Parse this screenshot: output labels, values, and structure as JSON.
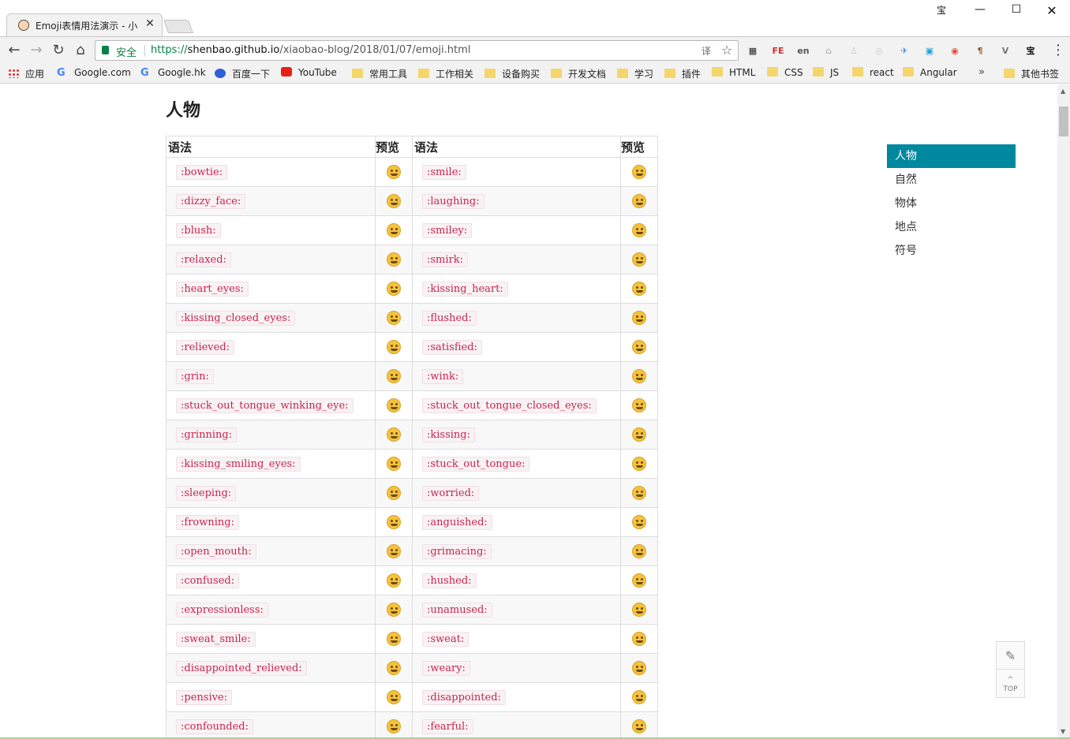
{
  "browser": {
    "tab_title": "Emoji表情用法演示 - 小",
    "tab_close": "✕",
    "window_controls": {
      "account": "宝",
      "minimize": "—",
      "maximize": "☐",
      "close": "✕"
    }
  },
  "toolbar": {
    "back": "←",
    "forward": "→",
    "reload": "↻",
    "home": "⌂",
    "secure_label": "安全",
    "url_scheme": "https://",
    "url_host": "shenbao.github.io",
    "url_path": "/xiaobao-blog/2018/01/07/emoji.html",
    "translate": "译",
    "star": "☆",
    "menu": "⋮",
    "extensions": [
      {
        "name": "qr-code-icon",
        "glyph": "▦",
        "color": "#222222"
      },
      {
        "name": "fe-helper-icon",
        "glyph": "FE",
        "color": "#d32f2f"
      },
      {
        "name": "en-dict-icon",
        "glyph": "en",
        "color": "#555555"
      },
      {
        "name": "pdf-icon",
        "glyph": "⌂",
        "color": "#bbbbbb"
      },
      {
        "name": "puzzle-icon",
        "glyph": "♙",
        "color": "#cccccc"
      },
      {
        "name": "circle-ext-icon",
        "glyph": "◎",
        "color": "#cccccc"
      },
      {
        "name": "bird-ext-icon",
        "glyph": "✈",
        "color": "#3b8fd8"
      },
      {
        "name": "window-ext-icon",
        "glyph": "▣",
        "color": "#2a9fd8"
      },
      {
        "name": "chrome-ext-icon",
        "glyph": "◉",
        "color": "#e04b3a"
      },
      {
        "name": "pilcrow-icon",
        "glyph": "¶",
        "color": "#8a5a1a"
      },
      {
        "name": "vue-devtools-icon",
        "glyph": "V",
        "color": "#777777"
      },
      {
        "name": "taobao-icon",
        "glyph": "宝",
        "color": "#111111"
      }
    ]
  },
  "bookmarks": {
    "apps": "应用",
    "items": [
      {
        "label": "Google.com",
        "type": "google"
      },
      {
        "label": "Google.hk",
        "type": "google"
      },
      {
        "label": "百度一下",
        "type": "baidu"
      },
      {
        "label": "YouTube",
        "type": "youtube"
      },
      {
        "label": "常用工具",
        "type": "folder"
      },
      {
        "label": "工作相关",
        "type": "folder"
      },
      {
        "label": "设备购买",
        "type": "folder"
      },
      {
        "label": "开发文档",
        "type": "folder"
      },
      {
        "label": "学习",
        "type": "folder"
      },
      {
        "label": "插件",
        "type": "folder"
      },
      {
        "label": "HTML",
        "type": "folder"
      },
      {
        "label": "CSS",
        "type": "folder"
      },
      {
        "label": "JS",
        "type": "folder"
      },
      {
        "label": "react",
        "type": "folder"
      },
      {
        "label": "Angular",
        "type": "folder"
      }
    ],
    "more": "»",
    "other": "其他书签"
  },
  "page": {
    "title": "人物",
    "table_headers": [
      "语法",
      "预览",
      "语法",
      "预览"
    ],
    "rows": [
      [
        ":bowtie:",
        ":smile:"
      ],
      [
        ":dizzy_face:",
        ":laughing:"
      ],
      [
        ":blush:",
        ":smiley:"
      ],
      [
        ":relaxed:",
        ":smirk:"
      ],
      [
        ":heart_eyes:",
        ":kissing_heart:"
      ],
      [
        ":kissing_closed_eyes:",
        ":flushed:"
      ],
      [
        ":relieved:",
        ":satisfied:"
      ],
      [
        ":grin:",
        ":wink:"
      ],
      [
        ":stuck_out_tongue_winking_eye:",
        ":stuck_out_tongue_closed_eyes:"
      ],
      [
        ":grinning:",
        ":kissing:"
      ],
      [
        ":kissing_smiling_eyes:",
        ":stuck_out_tongue:"
      ],
      [
        ":sleeping:",
        ":worried:"
      ],
      [
        ":frowning:",
        ":anguished:"
      ],
      [
        ":open_mouth:",
        ":grimacing:"
      ],
      [
        ":confused:",
        ":hushed:"
      ],
      [
        ":expressionless:",
        ":unamused:"
      ],
      [
        ":sweat_smile:",
        ":sweat:"
      ],
      [
        ":disappointed_relieved:",
        ":weary:"
      ],
      [
        ":pensive:",
        ":disappointed:"
      ],
      [
        ":confounded:",
        ":fearful:"
      ]
    ],
    "toc": [
      {
        "label": "人物",
        "active": true
      },
      {
        "label": "自然",
        "active": false
      },
      {
        "label": "物体",
        "active": false
      },
      {
        "label": "地点",
        "active": false
      },
      {
        "label": "符号",
        "active": false
      }
    ],
    "edit_icon": "✎",
    "top_arrow": "^",
    "top_label": "TOP"
  },
  "colors": {
    "accent": "#00889e",
    "code_text": "#c7254e",
    "code_bg": "#f9f2f4",
    "secure_green": "#0b8043"
  }
}
